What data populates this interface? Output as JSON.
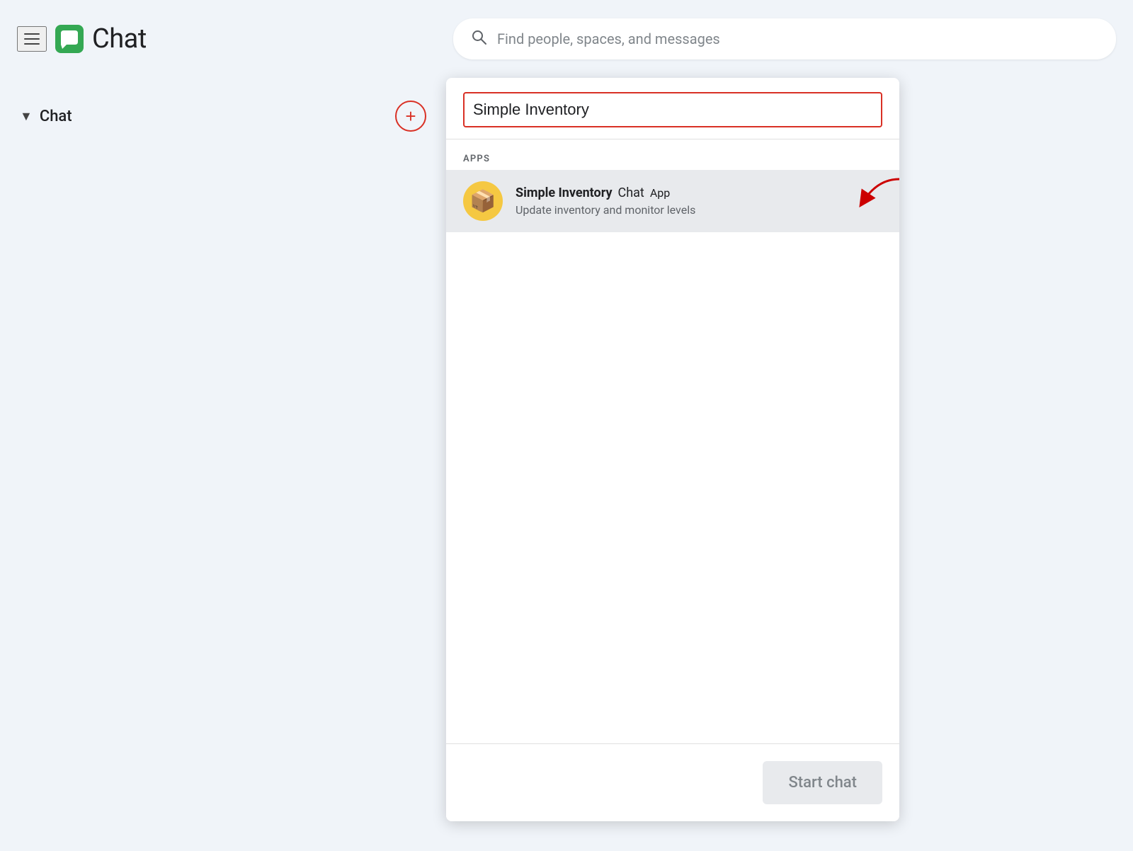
{
  "header": {
    "menu_icon": "☰",
    "app_name": "Chat",
    "search_placeholder": "Find people, spaces, and messages"
  },
  "sidebar": {
    "chat_section_label": "Chat",
    "add_button_label": "+"
  },
  "dropdown": {
    "search_value": "Simple Inventory",
    "apps_section_label": "APPS",
    "app_item": {
      "icon": "📦",
      "name_bold": "Simple Inventory",
      "name_suffix": "Chat",
      "badge": "App",
      "description": "Update inventory and monitor levels"
    },
    "footer_button": "Start chat"
  }
}
